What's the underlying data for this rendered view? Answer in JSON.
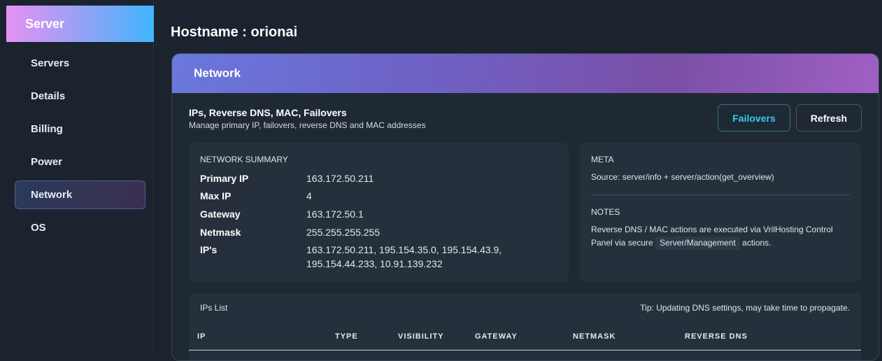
{
  "sidebar": {
    "title": "Server",
    "items": [
      {
        "label": "Servers"
      },
      {
        "label": "Details"
      },
      {
        "label": "Billing"
      },
      {
        "label": "Power"
      },
      {
        "label": "Network",
        "active": true
      },
      {
        "label": "OS"
      }
    ]
  },
  "page": {
    "hostname": "Hostname : orionai"
  },
  "card": {
    "title": "Network",
    "section_title": "IPs, Reverse DNS, MAC, Failovers",
    "section_subtitle": "Manage primary IP, failovers, reverse DNS and MAC addresses",
    "failovers_label": "Failovers",
    "refresh_label": "Refresh"
  },
  "summary": {
    "label": "NETWORK SUMMARY",
    "rows": [
      {
        "key": "Primary IP",
        "value": "163.172.50.211"
      },
      {
        "key": "Max IP",
        "value": "4"
      },
      {
        "key": "Gateway",
        "value": "163.172.50.1"
      },
      {
        "key": "Netmask",
        "value": "255.255.255.255"
      },
      {
        "key": "IP's",
        "value": "163.172.50.211, 195.154.35.0, 195.154.43.9, 195.154.44.233, 10.91.139.232"
      }
    ]
  },
  "meta": {
    "label": "META",
    "source": "Source: server/info + server/action(get_overview)",
    "notes_label": "NOTES",
    "notes_prefix": "Reverse DNS / MAC actions are executed via VrilHosting Control Panel via secure",
    "notes_code": "Server/Management",
    "notes_suffix": "actions."
  },
  "ips_list": {
    "title": "IPs List",
    "tip": "Tip: Updating DNS settings, may take time to propagate.",
    "columns": [
      "IP",
      "TYPE",
      "VISIBILITY",
      "GATEWAY",
      "NETMASK",
      "REVERSE DNS"
    ]
  },
  "colors": {
    "accent_cyan": "#3ec6f0",
    "background": "#1b242e",
    "panel": "#25303c"
  }
}
